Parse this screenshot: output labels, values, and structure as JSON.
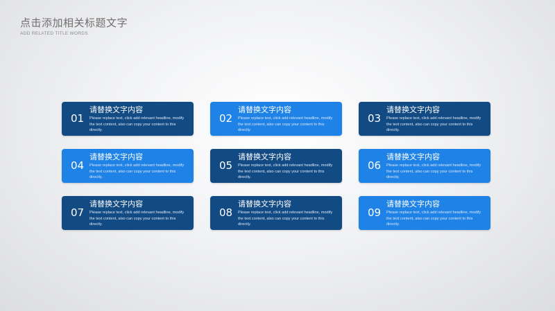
{
  "header": {
    "title": "点击添加相关标题文字",
    "subtitle": "ADD RELATED TITLE WORDS"
  },
  "colors": {
    "dark_card": "#124a84",
    "light_card": "#1e82e6"
  },
  "cards": [
    {
      "number": "01",
      "heading": "请替换文字内容",
      "body": "Please replace text, click add relevant headline, modify the text content, also can copy your content to this directly.",
      "style": "dark"
    },
    {
      "number": "02",
      "heading": "请替换文字内容",
      "body": "Please replace text, click add relevant headline, modify the text content, also can copy your content to this directly.",
      "style": "light"
    },
    {
      "number": "03",
      "heading": "请替换文字内容",
      "body": "Please replace text, click add relevant headline, modify the text content, also can copy your content to this directly.",
      "style": "dark"
    },
    {
      "number": "04",
      "heading": "请替换文字内容",
      "body": "Please replace text, click add relevant headline, modify the text content, also can copy your content to this directly.",
      "style": "light"
    },
    {
      "number": "05",
      "heading": "请替换文字内容",
      "body": "Please replace text, click add relevant headline, modify the text content, also can copy your content to this directly.",
      "style": "dark"
    },
    {
      "number": "06",
      "heading": "请替换文字内容",
      "body": "Please replace text, click add relevant headline, modify the text content, also can copy your content to this directly.",
      "style": "light"
    },
    {
      "number": "07",
      "heading": "请替换文字内容",
      "body": "Please replace text, click add relevant headline, modify the text content, also can copy your content to this directly.",
      "style": "dark"
    },
    {
      "number": "08",
      "heading": "请替换文字内容",
      "body": "Please replace text, click add relevant headline, modify the text content, also can copy your content to this directly.",
      "style": "dark"
    },
    {
      "number": "09",
      "heading": "请替换文字内容",
      "body": "Please replace text, click add relevant headline, modify the text content, also can copy your content to this directly.",
      "style": "light"
    }
  ]
}
